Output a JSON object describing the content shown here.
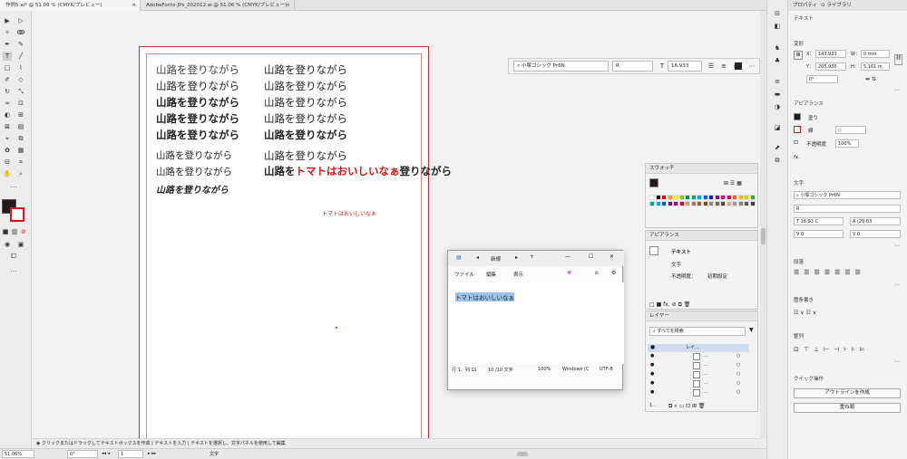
{
  "tabs": [
    {
      "label": "作例5.ai* @ 51.06 % (CMYK/プレビュー)",
      "close": "×"
    },
    {
      "label": "AdobeFonts-JPs_202012.ai @ 51.06 % (CMYK/プレビュー)",
      "close": "×"
    }
  ],
  "artboard": {
    "left_col": [
      "山路を登りながら",
      "山路を登りながら",
      "山路を登りながら",
      "山路を登りながら",
      "山路を登りながら",
      "山路を登りながら",
      "山路を登りながら",
      "山路を登りながら"
    ],
    "right_col": [
      "山路を登りながら",
      "山路を登りながら",
      "山路を登りながら",
      "山路を登りながら",
      "山路を登りながら",
      "山路を登りながら"
    ],
    "mixed_prefix": "山路を",
    "mixed_highlight": "トマトはおいしいなぁ",
    "mixed_suffix": "登りながら",
    "small_red": "トマトはおいしいなぁ"
  },
  "control_bar": {
    "font": "小塚ゴシック Pr6N",
    "style": "R",
    "size": "16.933"
  },
  "swatches_panel": {
    "title": "スウォッチ"
  },
  "appearance_panel": {
    "title": "アピアランス",
    "object": "テキスト",
    "row1": "文字",
    "opacity_label": "不透明度：",
    "opacity_value": "初期設定"
  },
  "layers_panel": {
    "title": "レイヤー",
    "search_placeholder": "すべてを検索",
    "layer_name": "レイ...",
    "item": "...",
    "count": "1..."
  },
  "notepad": {
    "tab_label": "新規",
    "menu": [
      "ファイル",
      "編集",
      "表示"
    ],
    "content": "トマトはおいしいなぁ",
    "status": [
      "行 1、列 11",
      "10 /10 文字",
      "100%",
      "Windows (C",
      "UTF-8"
    ]
  },
  "properties": {
    "tab1": "プロパティ",
    "tab2": "ライブラリ",
    "selection": "テキスト",
    "transform_title": "変形",
    "x_label": "X：",
    "x": "143.933",
    "y_label": "Y：",
    "y": "205.935",
    "w_label": "W：",
    "w": "0 mm",
    "h_label": "H：",
    "h": "5.161 m",
    "angle": "0°",
    "appearance_title": "アピアランス",
    "fill": "塗り",
    "stroke": "線",
    "opacity": "不透明度",
    "opacity_value": "100%",
    "fx": "fx.",
    "char_title": "文字",
    "font": "小塚ゴシック Pr6N",
    "style": "R",
    "size": "16.93 C",
    "leading": "(29.63",
    "kerning": "0",
    "tracking": "0",
    "para_title": "段落",
    "bullets_title": "箇条書き",
    "align_title": "整列",
    "quick_title": "クイック操作",
    "btn_outline": "アウトラインを作成",
    "btn_arrange": "重ね順"
  },
  "hint": "クリックまたはドラッグしてテキストボックスを作成 | テキストを入力 | テキストを選択し、文字パネルを使用して編集",
  "statusbar": {
    "zoom": "51.06%",
    "angle": "0°",
    "page": "1",
    "mode": "文字"
  },
  "colors": {
    "accent": "#d7141a",
    "artboard_border": "#b9302d",
    "selection": "#3b7ddd"
  }
}
